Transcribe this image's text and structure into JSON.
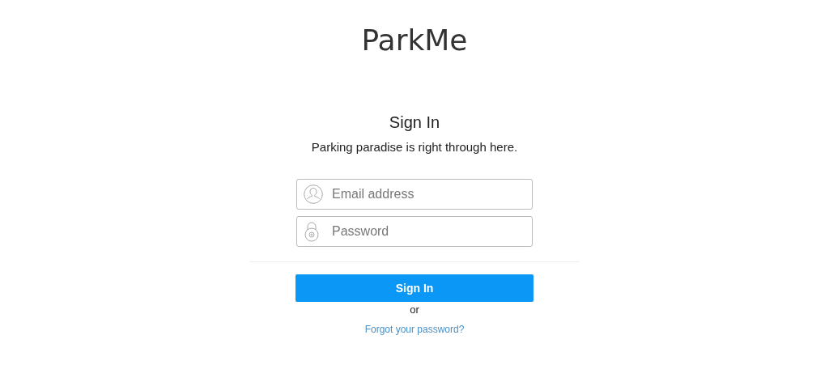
{
  "logo": "ParkMe",
  "title": "Sign In",
  "subtitle": "Parking paradise is right through here.",
  "fields": [
    {
      "kind": "email",
      "placeholder": "Email address"
    },
    {
      "kind": "password",
      "placeholder": "Password"
    }
  ],
  "submit": "Sign In",
  "separator": "or",
  "forgot_link": "Forgot your password?"
}
